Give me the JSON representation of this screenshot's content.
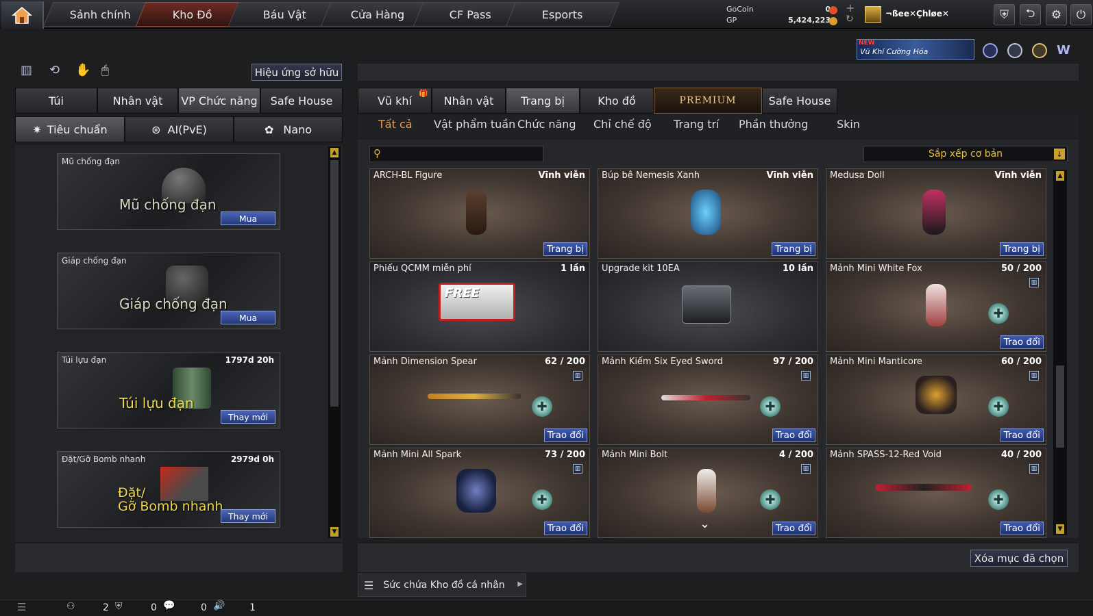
{
  "nav": {
    "tabs": [
      "Sảnh chính",
      "Kho Đồ",
      "Báu Vật",
      "Cửa Hàng",
      "CF Pass",
      "Esports"
    ]
  },
  "currency": {
    "gocoin_label": "GoCoin",
    "gp_label": "GP",
    "gocoin_value": "0",
    "gp_value": "5,424,223"
  },
  "user": {
    "name": "¬ßee✕Çhløe✕"
  },
  "promo": {
    "new": "NEW",
    "label": "Vũ Khí Cường Hóa"
  },
  "left": {
    "effect_button": "Hiệu ứng sở hữu",
    "tabs": [
      "Túi",
      "Nhân vật",
      "VP Chức năng",
      "Safe House"
    ],
    "subtabs": [
      "Tiêu chuẩn",
      "AI(PvE)",
      "Nano"
    ],
    "cards": [
      {
        "name": "Mũ chống đạn",
        "time": "",
        "big": "Mũ chống đạn",
        "button": "Mua"
      },
      {
        "name": "Giáp chống đạn",
        "time": "",
        "big": "Giáp chống đạn",
        "button": "Mua"
      },
      {
        "name": "Túi lựu đạn",
        "time": "1797d 20h",
        "big": "Túi lựu đạn",
        "button": "Thay mới"
      },
      {
        "name": "Đặt/Gỡ Bomb nhanh",
        "time": "2979d 0h",
        "big1": "Đặt/",
        "big2": "Gỡ Bomb nhanh",
        "button": "Thay mới"
      }
    ]
  },
  "right": {
    "tabs": [
      "Vũ khí",
      "Nhân vật",
      "Trang bị",
      "Kho đồ",
      "PREMIUM",
      "Safe House"
    ],
    "subtabs": [
      "Tất cả",
      "Vật phẩm tuần",
      "Chức năng",
      "Chỉ chế độ",
      "Trang trí",
      "Phần thưởng",
      "Skin"
    ],
    "sort": "Sắp xếp cơ bản",
    "search_placeholder": "",
    "items": [
      {
        "name": "ARCH-BL Figure",
        "qty": "Vĩnh viễn",
        "action": "Trang bị"
      },
      {
        "name": "Búp bê Nemesis Xanh",
        "qty": "Vĩnh viễn",
        "action": "Trang bị"
      },
      {
        "name": "Medusa Doll",
        "qty": "Vĩnh viễn",
        "action": "Trang bị"
      },
      {
        "name": "Phiếu QCMM miễn phí",
        "qty": "1 lần",
        "action": "",
        "free": "FREE"
      },
      {
        "name": "Upgrade kit 10EA",
        "qty": "10 lần",
        "action": ""
      },
      {
        "name": "Mảnh Mini White Fox",
        "qty": "50 / 200",
        "action": "Trao đổi"
      },
      {
        "name": "Mảnh Dimension Spear",
        "qty": "62 / 200",
        "action": "Trao đổi"
      },
      {
        "name": "Mảnh Kiếm Six Eyed Sword",
        "qty": "97 / 200",
        "action": "Trao đổi"
      },
      {
        "name": "Mảnh Mini Manticore",
        "qty": "60 / 200",
        "action": "Trao đổi"
      },
      {
        "name": "Mảnh Mini All Spark",
        "qty": "73 / 200",
        "action": "Trao đổi"
      },
      {
        "name": "Mảnh Mini Bolt",
        "qty": "4 / 200",
        "action": "Trao đổi"
      },
      {
        "name": "Mảnh SPASS-12-Red Void",
        "qty": "40 / 200",
        "action": "Trao đổi"
      }
    ],
    "delete_button": "Xóa mục đã chọn",
    "capacity": "Sức chứa Kho đồ cá nhân"
  },
  "status": {
    "v1": "2",
    "v2": "0",
    "v3": "0",
    "v4": "1"
  }
}
